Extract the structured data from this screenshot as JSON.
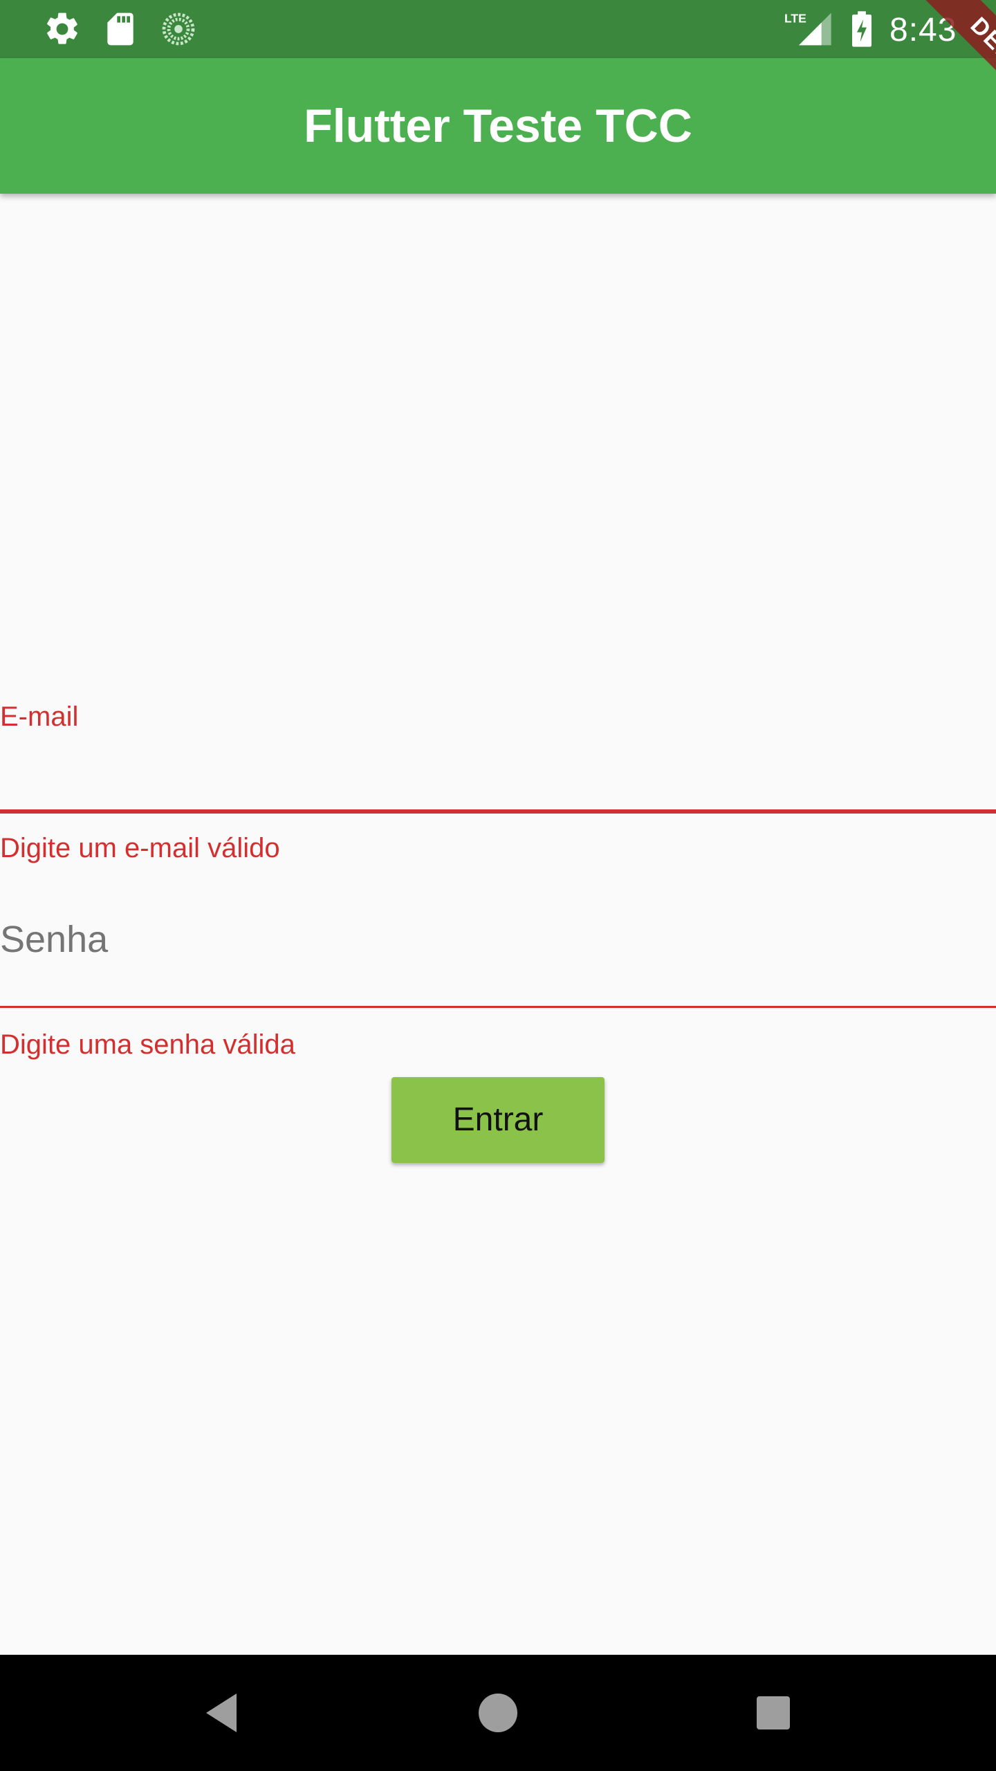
{
  "status_bar": {
    "time": "8:43",
    "left_icons": [
      "settings-icon",
      "sd-card-icon",
      "sync-icon"
    ],
    "right_icons": [
      "lte-signal-icon",
      "battery-charging-icon"
    ],
    "network_label": "LTE",
    "background": "#3b873e"
  },
  "app_bar": {
    "title": "Flutter Teste TCC",
    "background": "#4caf50"
  },
  "debug_banner": {
    "label": "DEBUG"
  },
  "form": {
    "email": {
      "label": "E-mail",
      "value": "",
      "error": "Digite um e-mail válido"
    },
    "senha": {
      "placeholder": "Senha",
      "value": "",
      "error": "Digite uma senha válida"
    },
    "submit_label": "Entrar",
    "error_color": "#d32f2f",
    "button_color": "#8bc34a"
  },
  "nav_bar": {
    "buttons": [
      "back-icon",
      "home-icon",
      "recents-icon"
    ]
  }
}
